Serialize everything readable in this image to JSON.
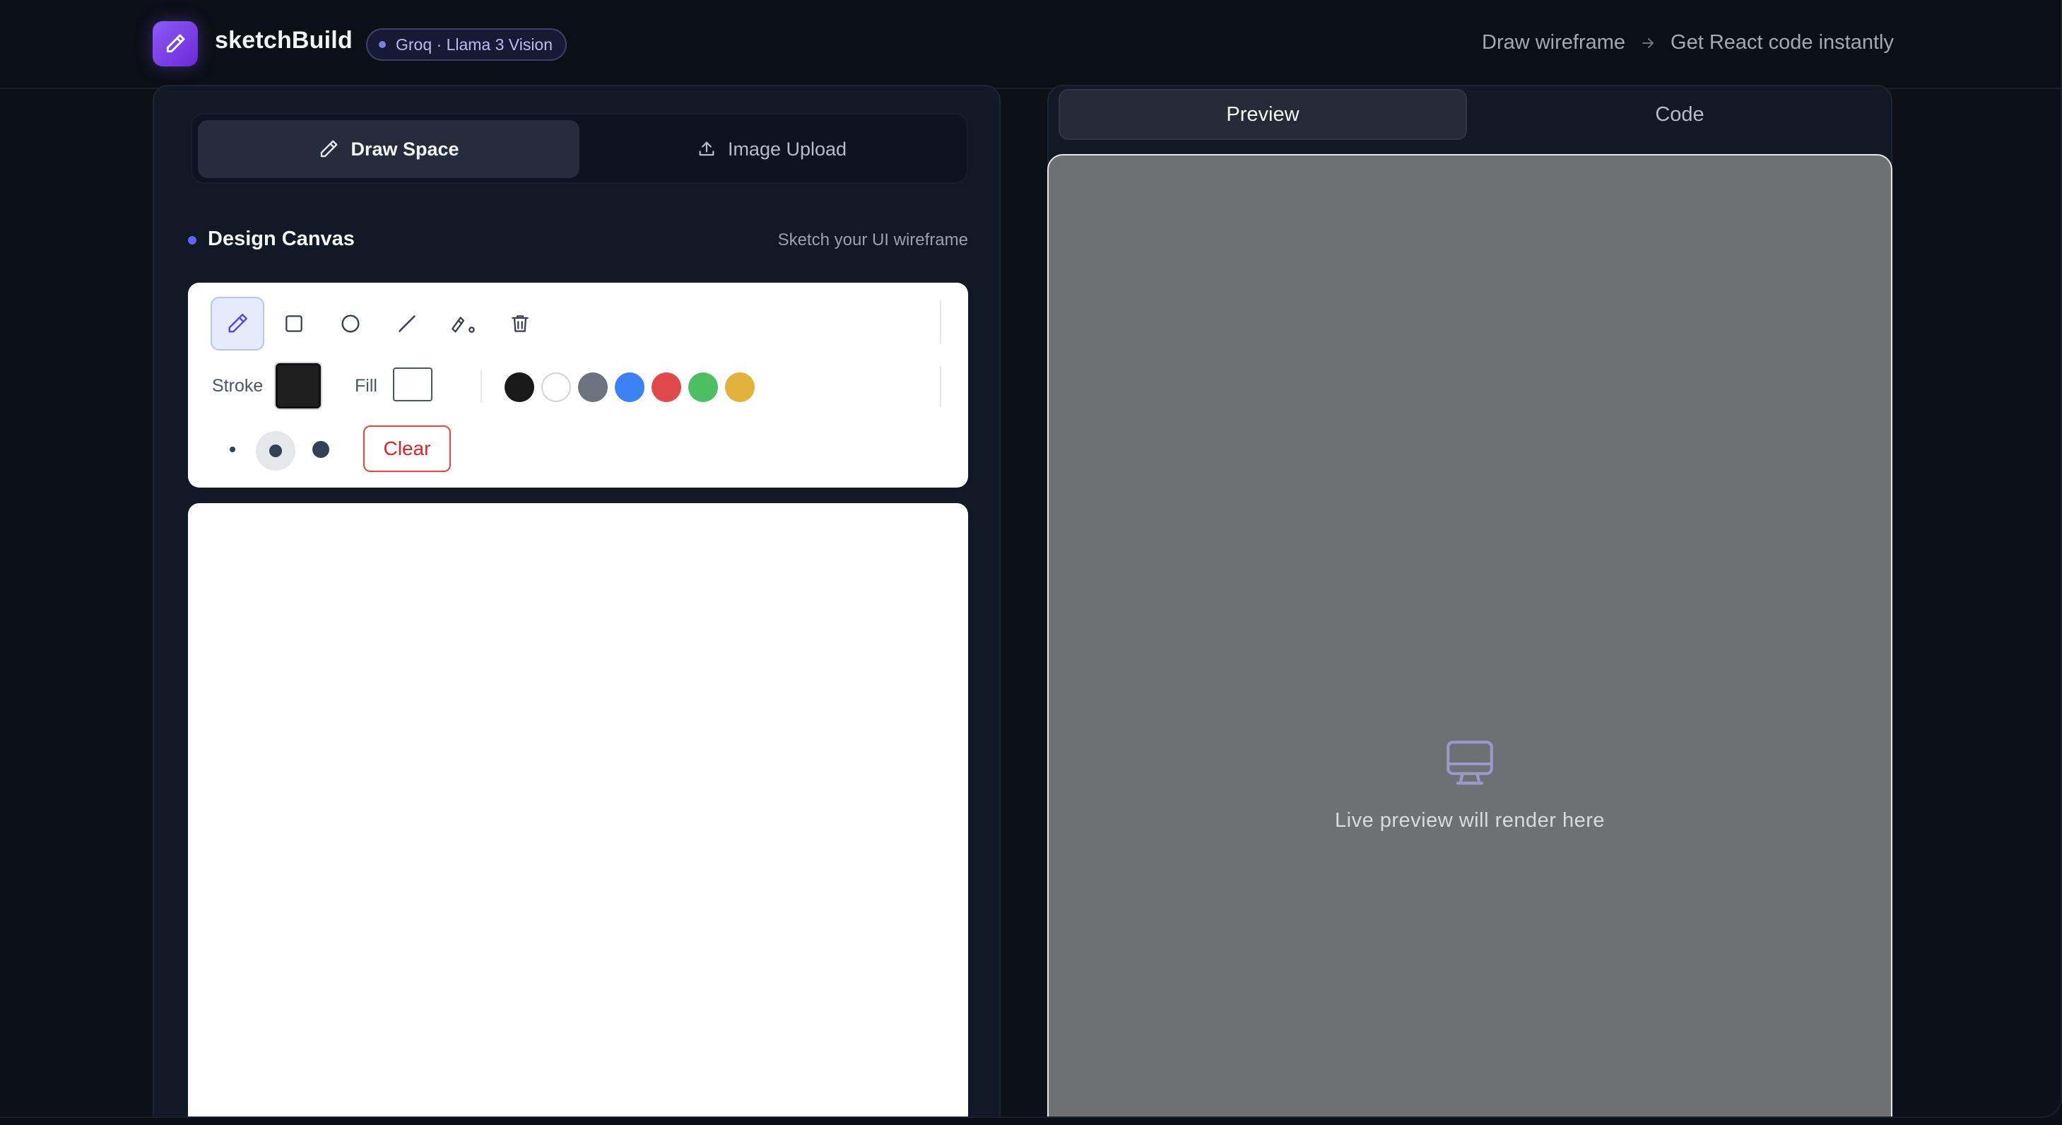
{
  "header": {
    "app_name": "sketchBuild",
    "model_badge": "Groq · Llama 3 Vision",
    "tagline_from": "Draw wireframe",
    "tagline_to": "Get React code instantly"
  },
  "input_modes": {
    "tabs": [
      {
        "label": "Draw Space",
        "icon": "pencil-icon",
        "active": true
      },
      {
        "label": "Image Upload",
        "icon": "upload-icon",
        "active": false
      }
    ]
  },
  "canvas": {
    "title": "Design Canvas",
    "subtitle": "Sketch your UI wireframe"
  },
  "toolbar": {
    "tools": [
      "pencil-icon",
      "rectangle-icon",
      "circle-icon",
      "line-icon",
      "eraser-icon",
      "trash-icon"
    ],
    "active_tool": "pencil-icon",
    "stroke_label": "Stroke",
    "fill_label": "Fill",
    "stroke_color": "#1f1f1f",
    "fill_color": "#ffffff",
    "palette": [
      "#1a1a1a",
      "#ffffff",
      "#6b7280",
      "#3b82f6",
      "#e04a4a",
      "#4cbf62",
      "#e3b23c"
    ],
    "brush_sizes": [
      "small",
      "medium",
      "large"
    ],
    "active_brush_size": "medium",
    "clear_label": "Clear"
  },
  "output": {
    "tabs": [
      {
        "label": "Preview",
        "active": true
      },
      {
        "label": "Code",
        "active": false
      }
    ],
    "empty_message": "Live preview will render here",
    "empty_icon": "monitor-icon"
  },
  "colors": {
    "accent": "#8b5cf6",
    "indicator": "#6366f1",
    "danger": "#dc2626"
  }
}
